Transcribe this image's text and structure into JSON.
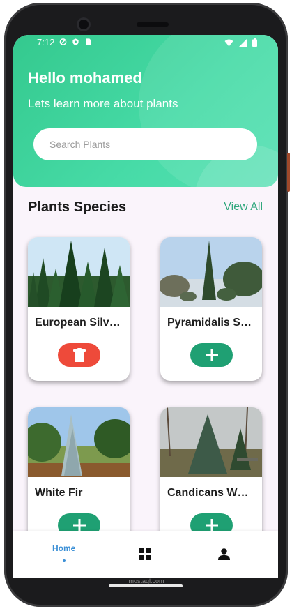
{
  "status_bar": {
    "time": "7:12"
  },
  "header": {
    "greeting": "Hello mohamed",
    "subtitle": "Lets learn more about plants"
  },
  "search": {
    "placeholder": "Search Plants",
    "value": ""
  },
  "section": {
    "title": "Plants Species",
    "view_all": "View All"
  },
  "plants": [
    {
      "name": "European Silv…",
      "action": "delete"
    },
    {
      "name": "Pyramidalis S…",
      "action": "add"
    },
    {
      "name": "White Fir",
      "action": "add"
    },
    {
      "name": "Candicans W…",
      "action": "add"
    }
  ],
  "bottom_nav": {
    "home_label": "Home",
    "items": [
      "home",
      "grid-icon",
      "user-icon"
    ]
  },
  "watermark": "mostaql.com",
  "colors": {
    "accent": "#34c98e",
    "add": "#1fa073",
    "delete": "#ee4a3a",
    "nav_active": "#3a8fd6"
  }
}
